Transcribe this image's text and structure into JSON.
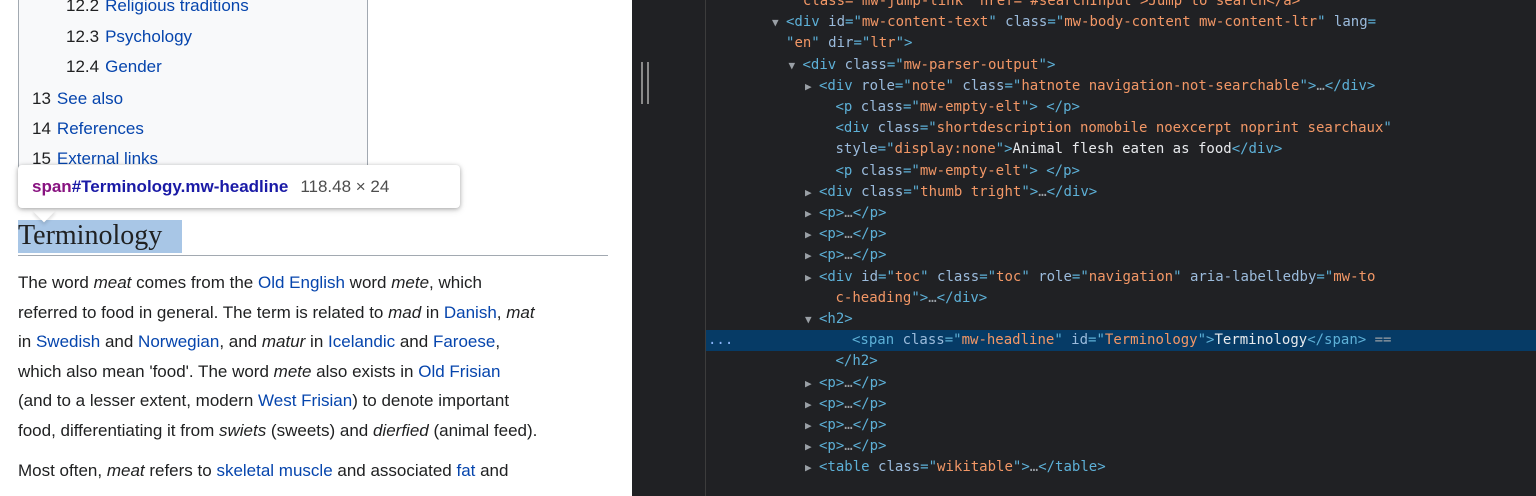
{
  "wiki": {
    "toc": [
      {
        "num": "12.2",
        "label": "Religious traditions",
        "indent": true
      },
      {
        "num": "12.3",
        "label": "Psychology",
        "indent": true
      },
      {
        "num": "12.4",
        "label": "Gender",
        "indent": true
      },
      {
        "num": "13",
        "label": "See also",
        "indent": false
      },
      {
        "num": "14",
        "label": "References",
        "indent": false
      },
      {
        "num": "15",
        "label": "External links",
        "indent": false
      }
    ],
    "tooltip": {
      "tag": "span",
      "selector": "#Terminology.mw-headline",
      "size": "118.48 × 24"
    },
    "heading": "Terminology",
    "para1": {
      "l1": [
        "The word ",
        "meat",
        " comes from the ",
        "Old English",
        " word ",
        "mete",
        ", which"
      ],
      "l2": [
        "referred to food in general. The term is related to ",
        "mad",
        " in ",
        "Danish",
        ", ",
        "mat"
      ],
      "l3": [
        "in ",
        "Swedish",
        " and ",
        "Norwegian",
        ", and ",
        "matur",
        " in ",
        "Icelandic",
        " and ",
        "Faroese",
        ","
      ],
      "l4": [
        "which also mean 'food'. The word ",
        "mete",
        " also exists in ",
        "Old Frisian"
      ],
      "l5": [
        "(and to a lesser extent, modern ",
        "West Frisian",
        ") to denote important"
      ],
      "l6": [
        "food, differentiating it from ",
        "swiets",
        " (sweets) and ",
        "dierfied",
        " (animal feed)."
      ]
    },
    "para2": {
      "l1": [
        "Most often, ",
        "meat",
        " refers to ",
        "skeletal muscle",
        " and associated ",
        "fat",
        " and"
      ]
    }
  },
  "devtools": {
    "lines": [
      {
        "row": 0,
        "indent": 4,
        "tri": "",
        "parts": [
          [
            "av",
            "\" class=\"mw-jump-link\" href=\"#searchInput\">Jump to search</a>"
          ]
        ]
      },
      {
        "row": 1,
        "indent": 4,
        "tri": "▼",
        "parts": [
          [
            "tg",
            "<div "
          ],
          [
            "an",
            "id"
          ],
          [
            "tg",
            "=\""
          ],
          [
            "av",
            "mw-content-text"
          ],
          [
            "tg",
            "\" "
          ],
          [
            "an",
            "class"
          ],
          [
            "tg",
            "=\""
          ],
          [
            "av",
            "mw-body-content mw-content-ltr"
          ],
          [
            "tg",
            "\" "
          ],
          [
            "an",
            "lang"
          ],
          [
            "tg",
            "="
          ]
        ]
      },
      {
        "row": 2,
        "indent": 4,
        "tri": "",
        "parts": [
          [
            "tg",
            "\""
          ],
          [
            "av",
            "en"
          ],
          [
            "tg",
            "\" "
          ],
          [
            "an",
            "dir"
          ],
          [
            "tg",
            "=\""
          ],
          [
            "av",
            "ltr"
          ],
          [
            "tg",
            "\">"
          ]
        ]
      },
      {
        "row": 3,
        "indent": 5,
        "tri": "▼",
        "parts": [
          [
            "tg",
            "<div "
          ],
          [
            "an",
            "class"
          ],
          [
            "tg",
            "=\""
          ],
          [
            "av",
            "mw-parser-output"
          ],
          [
            "tg",
            "\">"
          ]
        ]
      },
      {
        "row": 4,
        "indent": 6,
        "tri": "▶",
        "parts": [
          [
            "tg",
            "<div "
          ],
          [
            "an",
            "role"
          ],
          [
            "tg",
            "=\""
          ],
          [
            "av",
            "note"
          ],
          [
            "tg",
            "\" "
          ],
          [
            "an",
            "class"
          ],
          [
            "tg",
            "=\""
          ],
          [
            "av",
            "hatnote navigation-not-searchable"
          ],
          [
            "tg",
            "\">"
          ],
          [
            "dots",
            "…"
          ],
          [
            "tg",
            "</div>"
          ]
        ]
      },
      {
        "row": 5,
        "indent": 7,
        "tri": "",
        "parts": [
          [
            "tg",
            "<p "
          ],
          [
            "an",
            "class"
          ],
          [
            "tg",
            "=\""
          ],
          [
            "av",
            "mw-empty-elt"
          ],
          [
            "tg",
            "\"> </p>"
          ]
        ]
      },
      {
        "row": 6,
        "indent": 7,
        "tri": "",
        "parts": [
          [
            "tg",
            "<div "
          ],
          [
            "an",
            "class"
          ],
          [
            "tg",
            "=\""
          ],
          [
            "av",
            "shortdescription nomobile noexcerpt noprint searchaux"
          ],
          [
            "tg",
            "\""
          ]
        ]
      },
      {
        "row": 7,
        "indent": 7,
        "tri": "",
        "parts": [
          [
            "an",
            "style"
          ],
          [
            "tg",
            "=\""
          ],
          [
            "av",
            "display:none"
          ],
          [
            "tg",
            "\">"
          ],
          [
            "tx",
            "Animal flesh eaten as food"
          ],
          [
            "tg",
            "</div>"
          ]
        ]
      },
      {
        "row": 8,
        "indent": 7,
        "tri": "",
        "parts": [
          [
            "tg",
            "<p "
          ],
          [
            "an",
            "class"
          ],
          [
            "tg",
            "=\""
          ],
          [
            "av",
            "mw-empty-elt"
          ],
          [
            "tg",
            "\"> </p>"
          ]
        ]
      },
      {
        "row": 9,
        "indent": 6,
        "tri": "▶",
        "parts": [
          [
            "tg",
            "<div "
          ],
          [
            "an",
            "class"
          ],
          [
            "tg",
            "=\""
          ],
          [
            "av",
            "thumb tright"
          ],
          [
            "tg",
            "\">"
          ],
          [
            "dots",
            "…"
          ],
          [
            "tg",
            "</div>"
          ]
        ]
      },
      {
        "row": 10,
        "indent": 6,
        "tri": "▶",
        "parts": [
          [
            "tg",
            "<p>"
          ],
          [
            "dots",
            "…"
          ],
          [
            "tg",
            "</p>"
          ]
        ]
      },
      {
        "row": 11,
        "indent": 6,
        "tri": "▶",
        "parts": [
          [
            "tg",
            "<p>"
          ],
          [
            "dots",
            "…"
          ],
          [
            "tg",
            "</p>"
          ]
        ]
      },
      {
        "row": 12,
        "indent": 6,
        "tri": "▶",
        "parts": [
          [
            "tg",
            "<p>"
          ],
          [
            "dots",
            "…"
          ],
          [
            "tg",
            "</p>"
          ]
        ]
      },
      {
        "row": 13,
        "indent": 6,
        "tri": "▶",
        "parts": [
          [
            "tg",
            "<div "
          ],
          [
            "an",
            "id"
          ],
          [
            "tg",
            "=\""
          ],
          [
            "av",
            "toc"
          ],
          [
            "tg",
            "\" "
          ],
          [
            "an",
            "class"
          ],
          [
            "tg",
            "=\""
          ],
          [
            "av",
            "toc"
          ],
          [
            "tg",
            "\" "
          ],
          [
            "an",
            "role"
          ],
          [
            "tg",
            "=\""
          ],
          [
            "av",
            "navigation"
          ],
          [
            "tg",
            "\" "
          ],
          [
            "an",
            "aria-labelledby"
          ],
          [
            "tg",
            "=\""
          ],
          [
            "av",
            "mw-to"
          ]
        ]
      },
      {
        "row": 14,
        "indent": 7,
        "tri": "",
        "parts": [
          [
            "av",
            "c-heading"
          ],
          [
            "tg",
            "\">"
          ],
          [
            "dots",
            "…"
          ],
          [
            "tg",
            "</div>"
          ]
        ]
      },
      {
        "row": 15,
        "indent": 6,
        "tri": "▼",
        "parts": [
          [
            "tg",
            "<h2>"
          ]
        ]
      },
      {
        "row": 16,
        "indent": 8,
        "tri": "",
        "sel": true,
        "parts": [
          [
            "tg",
            "<span "
          ],
          [
            "an",
            "class"
          ],
          [
            "tg",
            "=\""
          ],
          [
            "av",
            "mw-headline"
          ],
          [
            "tg",
            "\" "
          ],
          [
            "an",
            "id"
          ],
          [
            "tg",
            "=\""
          ],
          [
            "av",
            "Terminology"
          ],
          [
            "tg",
            "\">"
          ],
          [
            "tx",
            "Terminology"
          ],
          [
            "tg",
            "</span>"
          ],
          [
            "eq",
            " =="
          ]
        ]
      },
      {
        "row": 17,
        "indent": 7,
        "tri": "",
        "parts": [
          [
            "tg",
            "</h2>"
          ]
        ]
      },
      {
        "row": 18,
        "indent": 6,
        "tri": "▶",
        "parts": [
          [
            "tg",
            "<p>"
          ],
          [
            "dots",
            "…"
          ],
          [
            "tg",
            "</p>"
          ]
        ]
      },
      {
        "row": 19,
        "indent": 6,
        "tri": "▶",
        "parts": [
          [
            "tg",
            "<p>"
          ],
          [
            "dots",
            "…"
          ],
          [
            "tg",
            "</p>"
          ]
        ]
      },
      {
        "row": 20,
        "indent": 6,
        "tri": "▶",
        "parts": [
          [
            "tg",
            "<p>"
          ],
          [
            "dots",
            "…"
          ],
          [
            "tg",
            "</p>"
          ]
        ]
      },
      {
        "row": 21,
        "indent": 6,
        "tri": "▶",
        "parts": [
          [
            "tg",
            "<p>"
          ],
          [
            "dots",
            "…"
          ],
          [
            "tg",
            "</p>"
          ]
        ]
      },
      {
        "row": 22,
        "indent": 6,
        "tri": "▶",
        "parts": [
          [
            "tg",
            "<table "
          ],
          [
            "an",
            "class"
          ],
          [
            "tg",
            "=\""
          ],
          [
            "av",
            "wikitable"
          ],
          [
            "tg",
            "\">"
          ],
          [
            "dots",
            "…"
          ],
          [
            "tg",
            "</table>"
          ]
        ]
      }
    ],
    "selected_dots": "...",
    "colors": {
      "background": "#202124",
      "selected_row": "#063b66",
      "tag": "#5db0d7",
      "attr_name": "#9bbbdc",
      "attr_value": "#f29766"
    }
  }
}
